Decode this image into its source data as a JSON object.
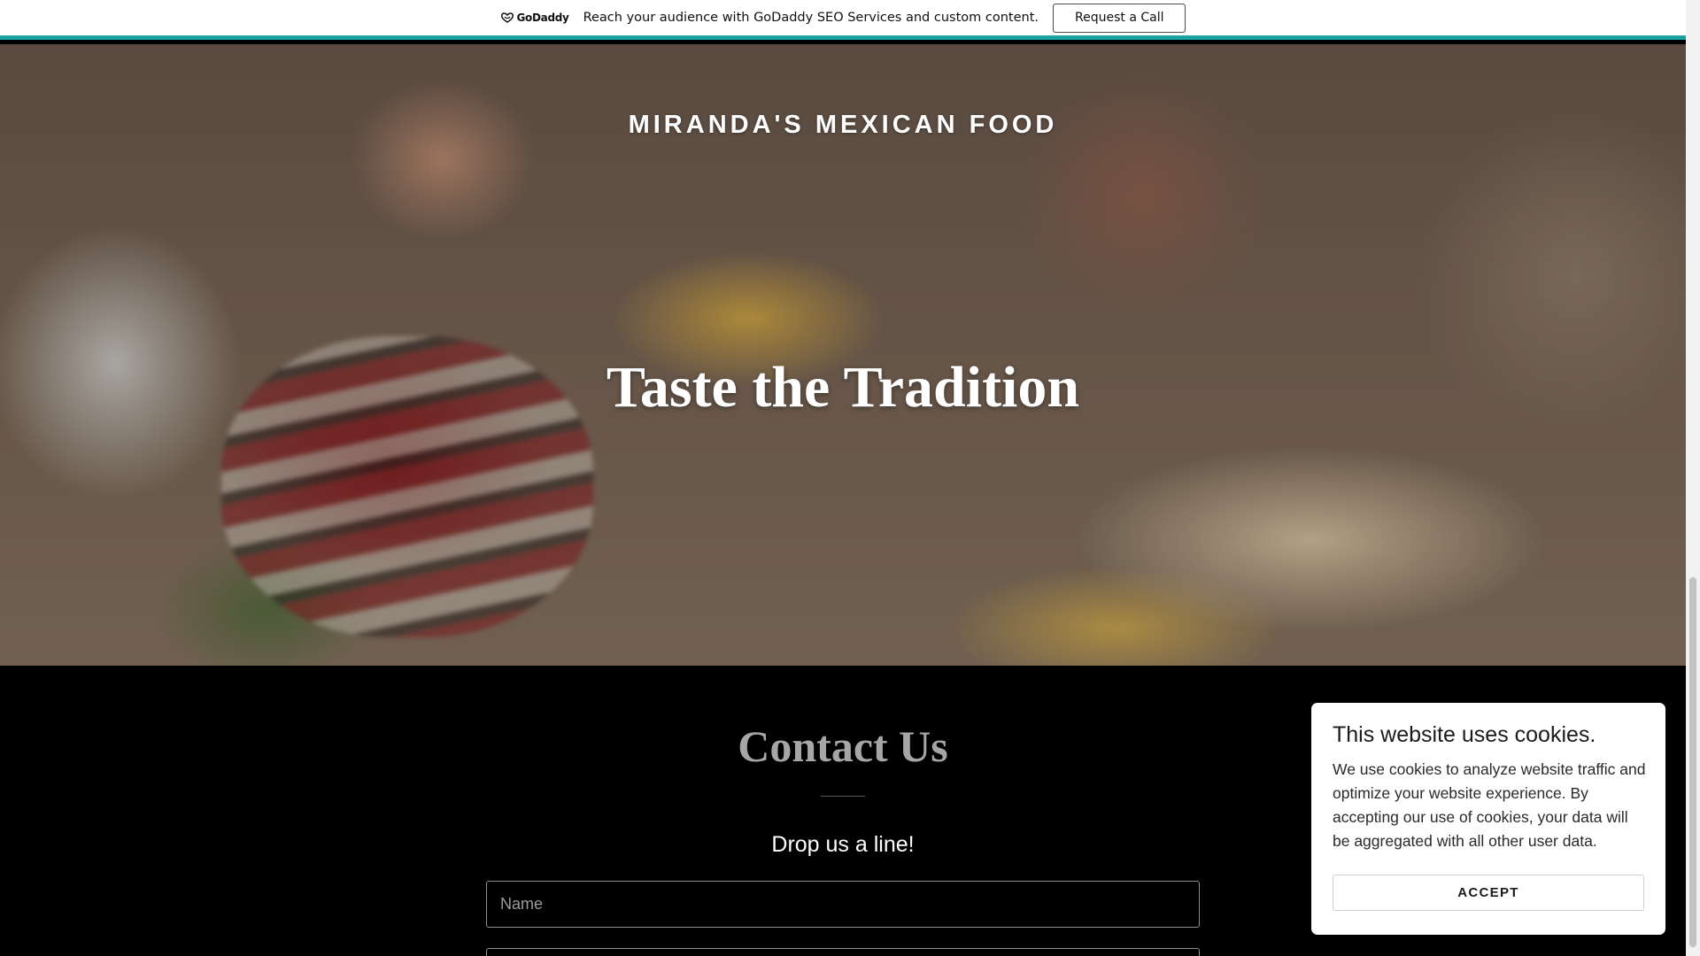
{
  "promo": {
    "logo_text": "GoDaddy",
    "message": "Reach your audience with GoDaddy SEO Services and custom content.",
    "cta_label": "Request a Call"
  },
  "hero": {
    "site_title": "MIRANDA'S MEXICAN FOOD",
    "headline": "Taste the Tradition"
  },
  "contact": {
    "heading": "Contact Us",
    "subheading": "Drop us a line!",
    "name_placeholder": "Name",
    "email_placeholder": ""
  },
  "cookie": {
    "title": "This website uses cookies.",
    "body": "We use cookies to analyze website traffic and optimize your website experience. By accepting our use of cookies, your data will be aggregated with all other user data.",
    "accept_label": "ACCEPT"
  },
  "colors": {
    "accent": "#1ba3a1",
    "background": "#000000",
    "heading_gray": "#a6a6a6"
  }
}
